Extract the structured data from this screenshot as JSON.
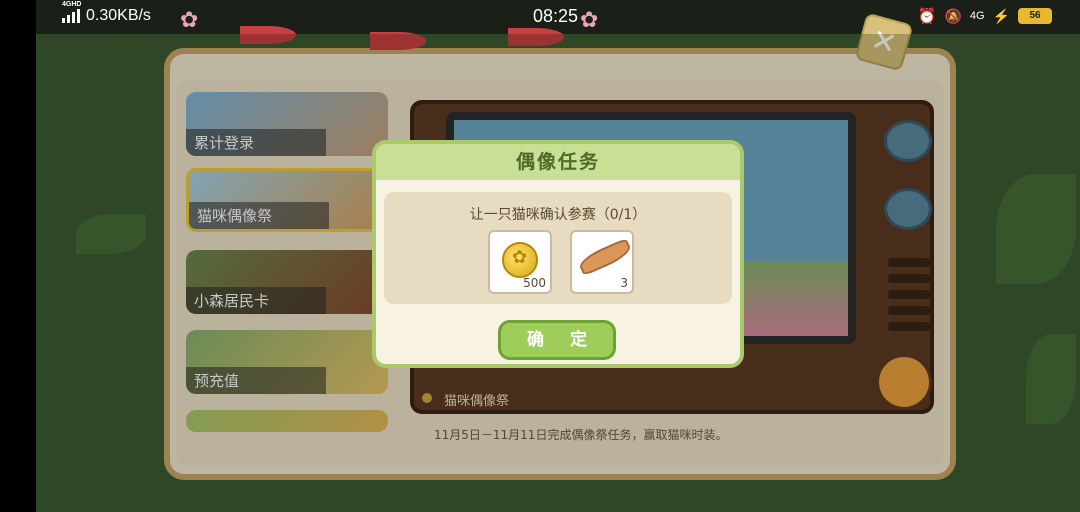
{
  "status_bar": {
    "network_speed": "0.30KB/s",
    "network_type": "4GHD",
    "time": "08:25",
    "mobile_data": "4G",
    "battery_level": "56"
  },
  "sidebar": {
    "tabs": [
      {
        "label": "累计登录"
      },
      {
        "label": "猫咪偶像祭",
        "active": true
      },
      {
        "label": "小森居民卡"
      },
      {
        "label": "预充值"
      },
      {
        "label": ""
      }
    ]
  },
  "event": {
    "name": "猫咪偶像祭",
    "description": "11月5日－11月11日完成偶像祭任务，赢取猫咪时装。"
  },
  "dialog": {
    "title": "偶像任务",
    "task": "让一只猫咪确认参赛（0/1）",
    "rewards": [
      {
        "icon": "gold-coin-icon",
        "count": "500"
      },
      {
        "icon": "dried-fish-icon",
        "count": "3"
      }
    ],
    "confirm_label": "确 定"
  },
  "colors": {
    "panel": "#f3ead0",
    "dialog_header": "#c9df96",
    "confirm_button": "#9fcd5a",
    "tv_frame": "#5c3a22"
  }
}
